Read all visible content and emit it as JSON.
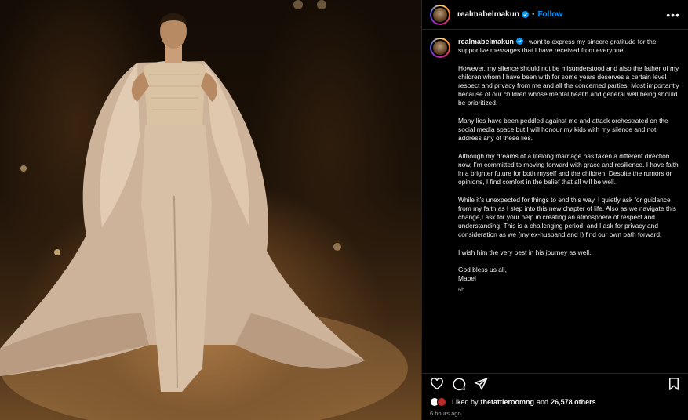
{
  "post": {
    "username": "realmabelmakun",
    "follow_label": "Follow",
    "separator": "•",
    "more_icon": "more-horizontal-icon",
    "photo_alt": "Woman in a beige embellished cape jumpsuit"
  },
  "caption": {
    "username": "realmabelmakun",
    "paragraphs": [
      "I want to express my sincere gratitude for the supportive messages that I have received from everyone.",
      "However, my silence should not be misunderstood and also the father of my children whom I have been with for some years deserves a certain level respect and privacy from me and all the concerned parties. Most importantly because of our children whose mental health and general well being should be prioritized.",
      "Many lies have been peddled against me and attack orchestrated on the social media space but I will honour my kids with my silence and not address any of these lies.",
      "Although my dreams of a lifelong marriage has taken a different direction now, I’m committed to moving forward with grace and resilience. I have faith in a brighter future for both myself and the children. Despite the rumors or opinions, I find comfort in the belief that all will be well.",
      "While it’s unexpected for things to end this way, I quietly ask for guidance from my faith as I step into this new chapter of life. Also as we navigate this change,I ask for your help in creating an atmosphere of respect and understanding. This is a challenging period, and I ask for privacy and consideration as we (my ex-husband and I) find our own path forward.",
      "I wish him the very best in his journey as well."
    ],
    "signoff_line1": "God bless us all,",
    "signoff_line2": "Mabel",
    "timestamp": "6h"
  },
  "engagement": {
    "liked_by_prefix": "Liked by",
    "liked_by_user": "thetattleroomng",
    "and_label": "and",
    "others_count": "26,578 others",
    "time_ago": "6 hours ago"
  },
  "colors": {
    "accent": "#0095f6",
    "background": "#000000",
    "muted": "#a8a8a8"
  }
}
